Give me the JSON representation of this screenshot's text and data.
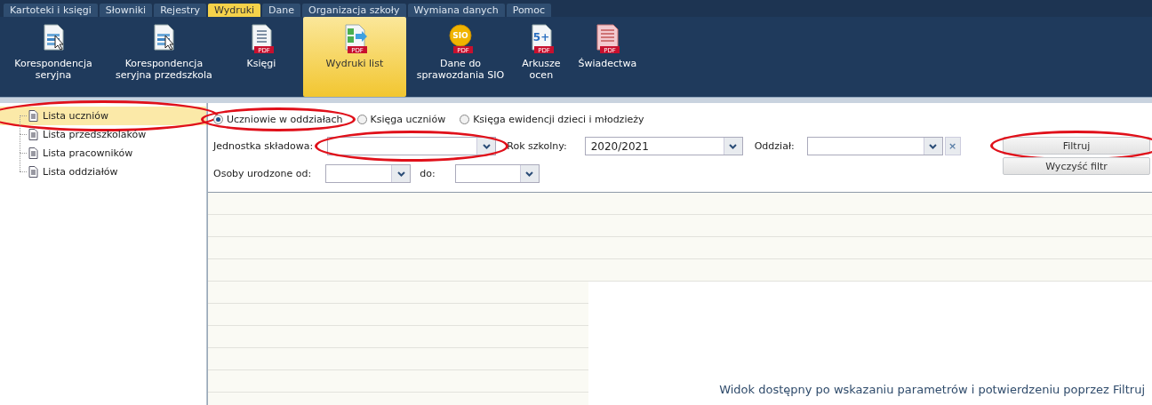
{
  "menu_tabs": [
    {
      "label": "Kartoteki i księgi",
      "selected": false
    },
    {
      "label": "Słowniki",
      "selected": false
    },
    {
      "label": "Rejestry",
      "selected": false
    },
    {
      "label": "Wydruki",
      "selected": true
    },
    {
      "label": "Dane",
      "selected": false
    },
    {
      "label": "Organizacja szkoły",
      "selected": false
    },
    {
      "label": "Wymiana danych",
      "selected": false
    },
    {
      "label": "Pomoc",
      "selected": false
    }
  ],
  "ribbon": [
    {
      "kind": "letter",
      "lines": [
        "Korespondencja",
        "seryjna"
      ],
      "selected": false
    },
    {
      "kind": "letter",
      "lines": [
        "Korespondencja",
        "seryjna przedszkola"
      ],
      "selected": false
    },
    {
      "kind": "book",
      "badge": "PDF",
      "lines": [
        "Księgi"
      ],
      "selected": false
    },
    {
      "kind": "list",
      "badge": "PDF",
      "lines": [
        "Wydruki list"
      ],
      "selected": true
    },
    {
      "kind": "coin",
      "icon_text": "SIO",
      "badge": "PDF",
      "lines": [
        "Dane do",
        "sprawozdania SIO"
      ],
      "selected": false
    },
    {
      "kind": "grade",
      "icon_text": "5+",
      "badge": "PDF",
      "lines": [
        "Arkusze",
        "ocen"
      ],
      "selected": false
    },
    {
      "kind": "certificate",
      "badge": "PDF",
      "lines": [
        "Świadectwa"
      ],
      "selected": false
    }
  ],
  "sidebar": {
    "items": [
      {
        "label": "Lista uczniów",
        "selected": true,
        "circled": true
      },
      {
        "label": "Lista przedszkolaków",
        "selected": false,
        "circled": false
      },
      {
        "label": "Lista pracowników",
        "selected": false,
        "circled": false
      },
      {
        "label": "Lista oddziałów",
        "selected": false,
        "circled": false
      }
    ]
  },
  "filter": {
    "radios": [
      {
        "label": "Uczniowie w oddziałach",
        "selected": true,
        "circled": true
      },
      {
        "label": "Księga uczniów",
        "selected": false,
        "circled": false
      },
      {
        "label": "Księga ewidencji dzieci i młodzieży",
        "selected": false,
        "circled": false
      }
    ],
    "unit": {
      "label": "Jednostka składowa:",
      "circled": true
    },
    "school_year": {
      "label": "Rok szkolny:",
      "value": "2020/2021"
    },
    "class": {
      "label": "Oddział:",
      "clear": "×"
    },
    "born_from": {
      "label": "Osoby urodzone od:"
    },
    "born_to": {
      "label": "do:"
    },
    "buttons": [
      {
        "label": "Filtruj",
        "circled": true
      },
      {
        "label": "Wyczyść filtr",
        "circled": false
      }
    ]
  },
  "results": {
    "message": "Widok dostępny po wskazaniu parametrów i potwierdzeniu poprzez Filtruj"
  }
}
